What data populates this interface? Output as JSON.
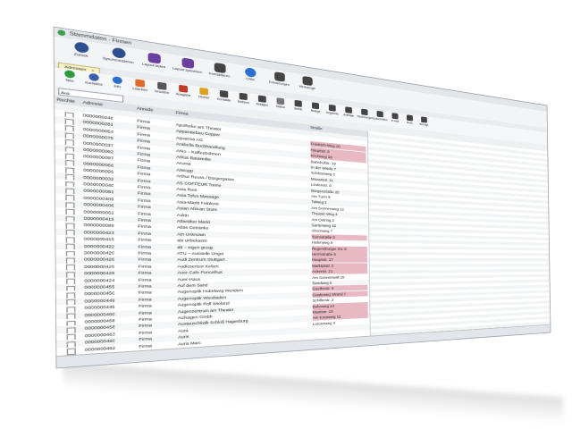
{
  "window": {
    "title": "Stammdaten · Firmen",
    "app_icon": "green-circle-icon"
  },
  "ribbon": {
    "buttons": [
      {
        "label": "Zurück",
        "icon": "back-arrow-icon"
      },
      {
        "label": "Synchronisieren",
        "icon": "sync-icon"
      },
      {
        "label": "Layout laden",
        "icon": "upload-icon"
      },
      {
        "label": "Layout speichern",
        "icon": "save-icon"
      },
      {
        "label": "Kontaktieren",
        "icon": "phone-icon"
      },
      {
        "label": "CRM",
        "icon": "people-icon"
      },
      {
        "label": "Erinnerungen",
        "icon": "alarm-clock-icon"
      },
      {
        "label": "Werkzeuge",
        "icon": "tools-icon"
      }
    ]
  },
  "tab": {
    "label": "Adressen"
  },
  "toolbar": {
    "buttons": [
      {
        "label": "Neu",
        "icon": "plus-icon",
        "color": "#2a9a3a"
      },
      {
        "label": "Korrektur",
        "icon": "pencil-icon",
        "color": "#3a5faa"
      },
      {
        "label": "Info",
        "icon": "info-icon",
        "color": "#2a6fd0"
      },
      {
        "label": "Löschen",
        "icon": "trash-icon",
        "color": "#e06a2a"
      },
      {
        "label": "Drucken",
        "icon": "window-icon",
        "color": "#555555"
      },
      {
        "label": "Ausgabe",
        "icon": "printer-icon",
        "color": "#c0392b"
      },
      {
        "label": "Ordner",
        "icon": "folder-icon",
        "color": "#e0a020"
      },
      {
        "label": "Kontakte",
        "icon": "contacts-icon",
        "color": "#444444"
      },
      {
        "label": "Notizen",
        "icon": "clipboard-icon",
        "color": "#444444"
      },
      {
        "label": "Anlagen",
        "icon": "paperclip-icon",
        "color": "#444444"
      },
      {
        "label": "Status",
        "icon": "close-x-icon",
        "color": "#777777"
      },
      {
        "label": "Briefe",
        "icon": "envelope-icon",
        "color": "#444444"
      },
      {
        "label": "Belege",
        "icon": "cash-register-icon",
        "color": "#444444"
      },
      {
        "label": "Angebote",
        "icon": "cash-register-icon",
        "color": "#444444"
      },
      {
        "label": "Aufträge",
        "icon": "cash-register-icon",
        "color": "#444444"
      },
      {
        "label": "Rechnungen",
        "icon": "document-icon",
        "color": "#444444"
      },
      {
        "label": "Gutschriften",
        "icon": "cash-register-icon",
        "color": "#444444"
      },
      {
        "label": "E-Mail",
        "icon": "envelope-icon",
        "color": "#444444"
      },
      {
        "label": "Bank",
        "icon": "bank-icon",
        "color": "#444444"
      },
      {
        "label": "Beträge",
        "icon": "money-bag-icon",
        "color": "#444444"
      }
    ]
  },
  "search": {
    "value": "Aus",
    "placeholder": ""
  },
  "columns": {
    "check": "Rechte",
    "nr": "Adresse",
    "type": "Anrede",
    "name": "Firma",
    "street": "Straße"
  },
  "rows": [
    {
      "nr": "0000000248",
      "type": "Firma",
      "name": "Apotheke am Theater",
      "street": "",
      "pink": false
    },
    {
      "nr": "0000000281",
      "type": "Firma",
      "name": "Apparatebau Copper",
      "street": "Friedrich-Weg 20",
      "pink": true
    },
    {
      "nr": "0000000054",
      "type": "Firma",
      "name": "Aquarisa AG",
      "street": "Hauptstr. 6",
      "pink": true
    },
    {
      "nr": "0000000075",
      "type": "Firma",
      "name": "Arabella Buchhandlung",
      "street": "Kirchweg 18",
      "pink": true
    },
    {
      "nr": "0000000037",
      "type": "Firma",
      "name": "Arko – Kaffeebohnen",
      "street": "Bahnhofstr. 19",
      "pink": false
    },
    {
      "nr": "0000000062",
      "type": "Firma",
      "name": "Arkus Bauwerke",
      "street": "In der Wiede 7",
      "pink": false
    },
    {
      "nr": "0000000097",
      "type": "Firma",
      "name": "Aroma",
      "street": "Schlossweg 3",
      "pink": false
    },
    {
      "nr": "0000000066",
      "type": "Firma",
      "name": "Arteopp",
      "street": "Mozartstr. 11",
      "pink": false
    },
    {
      "nr": "0000000095",
      "type": "Firma",
      "name": "Arthur Reuss / Bürgergasse",
      "street": "Lindenstr. 8",
      "pink": false
    },
    {
      "nr": "0000000032",
      "type": "Firma",
      "name": "AS COFFEUR Tonne",
      "street": "Bürgerstraße 20",
      "pink": false
    },
    {
      "nr": "0000000040",
      "type": "Firma",
      "name": "Asia Reis",
      "street": "Am Turm 9",
      "pink": false
    },
    {
      "nr": "0000000091",
      "type": "Firma",
      "name": "Asia Tofus Massage",
      "street": "Talweg 1",
      "pink": false
    },
    {
      "nr": "0000000409",
      "type": "Firma",
      "name": "Asia-Markt Feinkost",
      "street": "Am Sonnenweg 12",
      "pink": false
    },
    {
      "nr": "0000000406",
      "type": "Firma",
      "name": "Asian African Store",
      "street": "Theater-Weg 4",
      "pink": false
    },
    {
      "nr": "0000000062",
      "type": "Firma",
      "name": "Askin",
      "street": "Am Ostring 2",
      "pink": false
    },
    {
      "nr": "0000000419",
      "type": "Firma",
      "name": "Atlantiker Markt",
      "street": "Gartenweg 15",
      "pink": false
    },
    {
      "nr": "0000000089",
      "type": "Firma",
      "name": "Atlas Getränke",
      "street": "Ahornweg 7",
      "pink": false
    },
    {
      "nr": "0000000423",
      "type": "Firma",
      "name": "Atn Unknown",
      "street": "Turmstraße 5",
      "pink": true
    },
    {
      "nr": "0000000415",
      "type": "Firma",
      "name": "ats unbekannt",
      "street": "Hafenweg 9",
      "pink": false
    },
    {
      "nr": "0000000422",
      "type": "Firma",
      "name": "att – eigen group",
      "street": "Regensburger Str. 8",
      "pink": true
    },
    {
      "nr": "0000000420",
      "type": "Firma",
      "name": "ATU – Autoteile Unger",
      "street": "Herrnstraße 8",
      "pink": true
    },
    {
      "nr": "0000000426",
      "type": "Firma",
      "name": "Audi Zentrum Stuttgart",
      "street": "Hauptstr. 17",
      "pink": true
    },
    {
      "nr": "0000000425",
      "type": "Firma",
      "name": "Audiosensor Kelten",
      "street": "Marktplatz 3",
      "pink": true
    },
    {
      "nr": "0000000428",
      "type": "Firma",
      "name": "Auer-Cafe Poncelhus",
      "street": "Ackerstr. 21",
      "pink": true
    },
    {
      "nr": "0000000424",
      "type": "Firma",
      "name": "Auer-Haus",
      "street": "Am Sonnenwall 18",
      "pink": false
    },
    {
      "nr": "0000000455",
      "type": "Firma",
      "name": "Auf dem Sand",
      "street": "Sandweg 6",
      "pink": false
    },
    {
      "nr": "0000000450",
      "type": "Firma",
      "name": "Augenoptik Hubelweg Wendern",
      "street": "Goethestr. 5",
      "pink": true
    },
    {
      "nr": "0000000449",
      "type": "Firma",
      "name": "Augenoptik Wiesbaden",
      "street": "Gradeweg Strand 7",
      "pink": true
    },
    {
      "nr": "0000000445",
      "type": "Firma",
      "name": "Augenoptik Rolf Wieland",
      "street": "Schillerstr. 2",
      "pink": false
    },
    {
      "nr": "0000000460",
      "type": "Firma",
      "name": "Augenzentrum am Theater",
      "street": "Bahnweg 14",
      "pink": true
    },
    {
      "nr": "0000000458",
      "type": "Firma",
      "name": "Aufsagen Gmbh",
      "street": "Marktstr. 10",
      "pink": true
    },
    {
      "nr": "0000000458",
      "type": "Firma",
      "name": "Austauschkalk Schloß Hagenburg",
      "street": "Am Kreisweg 12",
      "pink": true
    },
    {
      "nr": "0000000463",
      "type": "Firma",
      "name": "Aura",
      "street": "Lorenzweg 4",
      "pink": false
    },
    {
      "nr": "0000000460",
      "type": "Firma",
      "name": "Auris",
      "street": "",
      "pink": false
    },
    {
      "nr": "0000000462",
      "type": "Firma",
      "name": "Auris Marc",
      "street": "",
      "pink": false
    }
  ],
  "colors": {
    "accent": "#3a6fc4",
    "pink": "#e8b9c2",
    "highlight": "#f3ea55"
  }
}
